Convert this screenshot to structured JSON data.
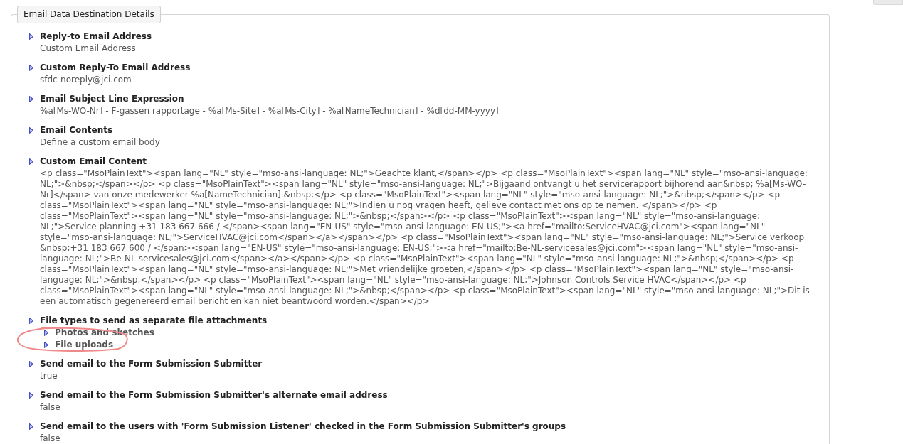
{
  "fieldset": {
    "legend": "Email Data Destination Details"
  },
  "properties": [
    {
      "label": "Reply-to Email Address",
      "value": "Custom Email Address"
    },
    {
      "label": "Custom Reply-To Email Address",
      "value": "sfdc-noreply@jci.com"
    },
    {
      "label": "Email Subject Line Expression",
      "value": "%a[Ms-WO-Nr] - F-gassen rapportage - %a[Ms-Site] - %a[Ms-City] - %a[NameTechnician] - %d[dd-MM-yyyy]"
    },
    {
      "label": "Email Contents",
      "value": "Define a custom email body"
    },
    {
      "label": "Custom Email Content",
      "value": "<p class=\"MsoPlainText\"><span lang=\"NL\" style=\"mso-ansi-language: NL;\">Geachte klant,</span></p> <p class=\"MsoPlainText\"><span lang=\"NL\" style=\"mso-ansi-language: NL;\">&nbsp;</span></p> <p class=\"MsoPlainText\"><span lang=\"NL\" style=\"mso-ansi-language: NL;\">Bijgaand ontvangt u het servicerapport bijhorend aan&nbsp; %a[Ms-WO-Nr]</span> van onze medewerker %a[NameTechnician].&nbsp;</p> <p class=\"MsoPlainText\"><span lang=\"NL\" style=\"mso-ansi-language: NL;\">&nbsp;</span></p> <p class=\"MsoPlainText\"><span lang=\"NL\" style=\"mso-ansi-language: NL;\">Indien u nog vragen heeft, gelieve contact met ons op te nemen. </span></p> <p class=\"MsoPlainText\"><span lang=\"NL\" style=\"mso-ansi-language: NL;\">&nbsp;</span></p> <p class=\"MsoPlainText\"><span lang=\"NL\" style=\"mso-ansi-language: NL;\">Service planning +31 183 667 666 / </span><span lang=\"EN-US\" style=\"mso-ansi-language: EN-US;\"><a href=\"mailto:ServiceHVAC@jci.com\"><span lang=\"NL\" style=\"mso-ansi-language: NL;\">ServiceHVAC@jci.com</span></a></span></p> <p class=\"MsoPlainText\"><span lang=\"NL\" style=\"mso-ansi-language: NL;\">Service verkoop &nbsp;+31 183 667 600 / </span><span lang=\"EN-US\" style=\"mso-ansi-language: EN-US;\"><a href=\"mailto:Be-NL-servicesales@jci.com\"><span lang=\"NL\" style=\"mso-ansi-language: NL;\">Be-NL-servicesales@jci.com</span></a></span></p> <p class=\"MsoPlainText\"><span lang=\"NL\" style=\"mso-ansi-language: NL;\">&nbsp;</span></p> <p class=\"MsoPlainText\"><span lang=\"NL\" style=\"mso-ansi-language: NL;\">Met vriendelijke groeten,</span></p> <p class=\"MsoPlainText\"><span lang=\"NL\" style=\"mso-ansi-language: NL;\">&nbsp;</span></p> <p class=\"MsoPlainText\"><span lang=\"NL\" style=\"mso-ansi-language: NL;\">Johnson Controls Service HVAC</span></p> <p class=\"MsoPlainText\"><span lang=\"NL\" style=\"mso-ansi-language: NL;\">&nbsp;</span></p> <p class=\"MsoPlainText\"><span lang=\"NL\" style=\"mso-ansi-language: NL;\">Dit is een automatisch gegenereerd email bericht en kan niet beantwoord worden.</span></p>"
    },
    {
      "label": "File types to send as separate file attachments",
      "circled": true,
      "children": [
        {
          "label": "Photos and sketches"
        },
        {
          "label": "File uploads"
        }
      ]
    },
    {
      "label": "Send email to the Form Submission Submitter",
      "value": "true"
    },
    {
      "label": "Send email to the Form Submission Submitter's alternate email address",
      "value": "false"
    },
    {
      "label": "Send email to the users with 'Form Submission Listener' checked in the Form Submission Submitter's groups",
      "value": "false"
    }
  ]
}
